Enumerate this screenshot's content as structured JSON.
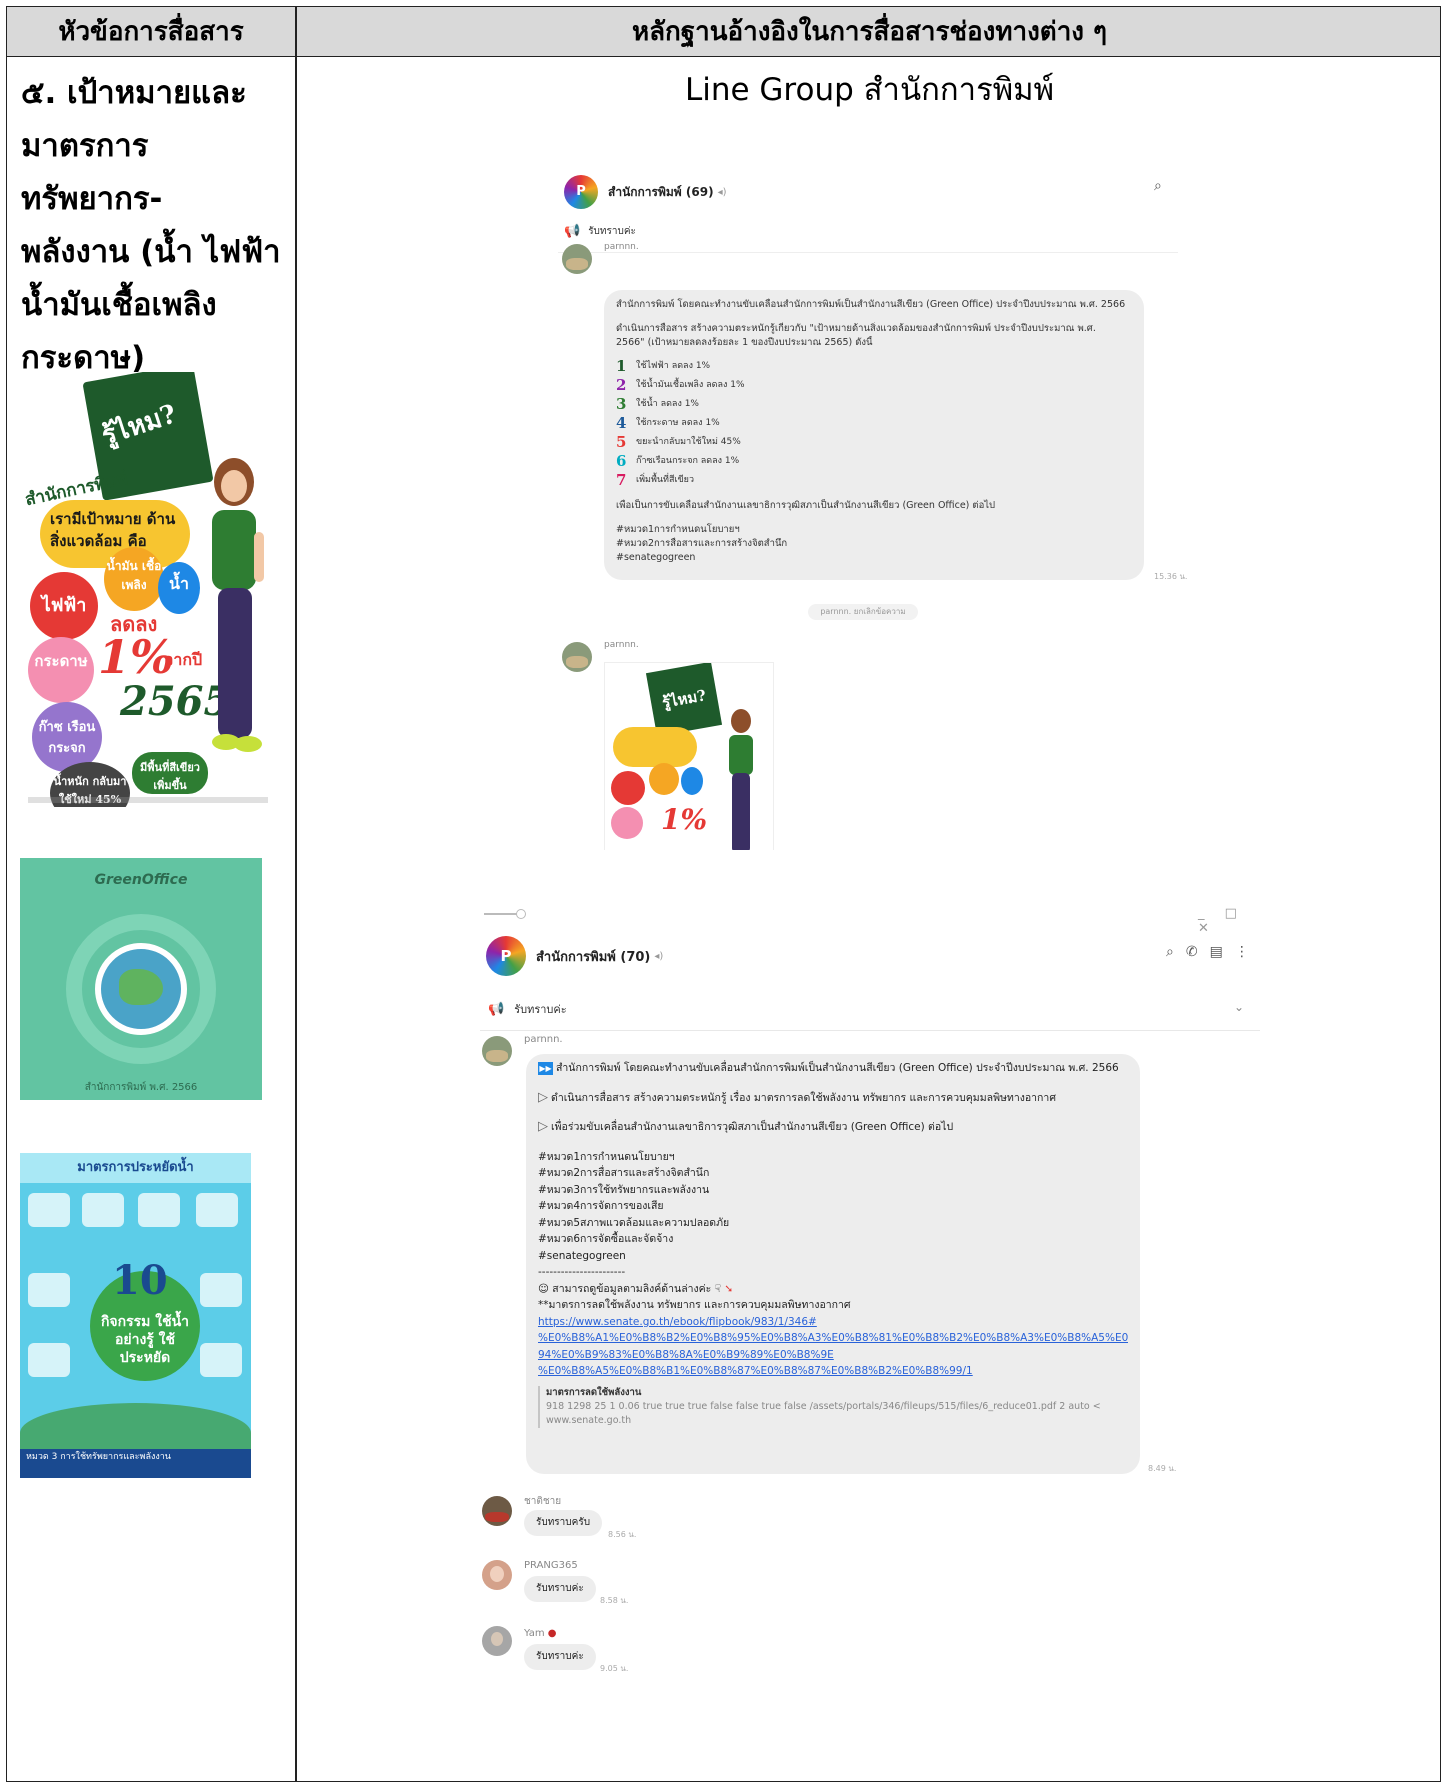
{
  "table": {
    "col1_header": "หัวข้อการสื่อสาร",
    "col2_header": "หลักฐานอ้างอิงในการสื่อสารช่องทางต่าง ๆ",
    "topic_lines": [
      "๕. เป้าหมายและ",
      "มาตรการทรัพยากร-",
      "พลังงาน (น้ำ ไฟฟ้า",
      "น้ำมันเชื้อเพลิง",
      "กระดาษ)"
    ],
    "evidence_title": "Line Group สำนักการพิมพ์"
  },
  "poster1": {
    "board_text": "รู้ไหม?",
    "title": "สำนักการพิมพ์",
    "bubble": "เรามีเป้าหมาย ด้านสิ่งแวดล้อม คือ",
    "circle_electric": "ไฟฟ้า",
    "circle_fuel": "น้ำมัน เชื้อเพลิง",
    "circle_water": "น้ำ",
    "circle_paper": "กระดาษ",
    "circle_gas": "ก๊าซ เรือนกระจก",
    "circle_recycle": "น้ำหนัก กลับมา ใช้ใหม่ 45%",
    "circle_green": "มีพื้นที่สีเขียว เพิ่มขึ้น",
    "reduce": "ลดลง",
    "percent": "1%",
    "from_year": "จากปี",
    "year": "2565"
  },
  "poster2": {
    "title": "GreenOffice",
    "footer": "สำนักการพิมพ์ พ.ศ. 2566"
  },
  "poster3": {
    "title": "มาตรการประหยัดน้ำ",
    "number": "10",
    "activity": "กิจกรรม ใช้น้ำอย่างรู้ ใช้ประหยัด",
    "footer": "หมวด 3 การใช้ทรัพยากรและพลังงาน"
  },
  "chat1": {
    "group_name": "สำนักการพิมพ์ (69)",
    "announcement": "รับทราบค่ะ",
    "sender": "parnnn.",
    "lines_top": [
      "สำนักการพิมพ์ โดยคณะทำงานขับเคลื่อนสำนักการพิมพ์เป็นสำนักงานสีเขียว (Green Office) ประจำปีงบประมาณ พ.ศ. 2566",
      "ดำเนินการสื่อสาร สร้างความตระหนักรู้เกี่ยวกับ \"เป้าหมายด้านสิ่งแวดล้อมของสำนักการพิมพ์ ประจำปีงบประมาณ พ.ศ.",
      "2566\" (เป้าหมายลดลงร้อยละ 1 ของปีงบประมาณ 2565) ดังนี้"
    ],
    "items": [
      {
        "num": "1",
        "color": "#1e5a2b",
        "text": "ใช้ไฟฟ้า ลดลง 1%"
      },
      {
        "num": "2",
        "color": "#8e24aa",
        "text": "ใช้น้ำมันเชื้อเพลิง ลดลง 1%"
      },
      {
        "num": "3",
        "color": "#2e7d32",
        "text": "ใช้น้ำ ลดลง 1%"
      },
      {
        "num": "4",
        "color": "#1e5a9a",
        "text": "ใช้กระดาษ ลดลง 1%"
      },
      {
        "num": "5",
        "color": "#e53935",
        "text": "ขยะนำกลับมาใช้ใหม่ 45%"
      },
      {
        "num": "6",
        "color": "#00acc1",
        "text": "ก๊าซเรือนกระจก ลดลง 1%"
      },
      {
        "num": "7",
        "color": "#d81b60",
        "text": "เพิ่มพื้นที่สีเขียว"
      }
    ],
    "closing": "เพื่อเป็นการขับเคลื่อนสำนักงานเลขาธิการวุฒิสภาเป็นสำนักงานสีเขียว (Green Office) ต่อไป",
    "tags": [
      "#หมวด1การกำหนดนโยบายฯ",
      "#หมวด2การสื่อสารและการสร้างจิตสำนึก",
      "#senategogreen"
    ],
    "time": "15.36 น.",
    "system": "parnnn. ยกเลิกข้อความ",
    "sender2": "parnnn."
  },
  "chat2": {
    "group_name": "สำนักการพิมพ์ (70)",
    "announcement": "รับทราบค่ะ",
    "sender": "parnnn.",
    "line1": "สำนักการพิมพ์ โดยคณะทำงานขับเคลื่อนสำนักการพิมพ์เป็นสำนักงานสีเขียว (Green Office) ประจำปีงบประมาณ พ.ศ. 2566",
    "line2": "ดำเนินการสื่อสาร สร้างความตระหนักรู้ เรื่อง มาตรการลดใช้พลังงาน ทรัพยากร และการควบคุมมลพิษทางอากาศ",
    "line3": "เพื่อร่วมขับเคลื่อนสำนักงานเลขาธิการวุฒิสภาเป็นสำนักงานสีเขียว (Green Office) ต่อไป",
    "tags": [
      "#หมวด1การกำหนดนโยบายฯ",
      "#หมวด2การสื่อสารและสร้างจิตสำนึก",
      "#หมวด3การใช้ทรัพยากรและพลังงาน",
      "#หมวด4การจัดการของเสีย",
      "#หมวด5สภาพแวดล้อมและความปลอดภัย",
      "#หมวด6การจัดซื้อและจัดจ้าง",
      "#senategogreen"
    ],
    "divider": "-----------------------",
    "see_more": "สามารถดูข้อมูลตามลิงค์ด้านล่างค่ะ",
    "measure": "**มาตรการลดใช้พลังงาน ทรัพยากร และการควบคุมมลพิษทางอากาศ",
    "link_lines": [
      "https://www.senate.go.th/ebook/flipbook/983/1/346#",
      "%E0%B8%A1%E0%B8%B2%E0%B8%95%E0%B8%A3%E0%B8%81%E0%B8%B2%E0%B8%A3%E0%B8%A5%E0%B8%",
      "94%E0%B9%83%E0%B8%8A%E0%B9%89%E0%B8%9E",
      "%E0%B8%A5%E0%B8%B1%E0%B8%87%E0%B8%87%E0%B8%B2%E0%B8%99/1"
    ],
    "preview_title": "มาตรการลดใช้พลังงาน",
    "preview_body1": "918 1298 25 1 0.06 true true true false false true false /assets/portals/346/fileups/515/files/6_reduce01.pdf 2 auto <",
    "preview_body2": "www.senate.go.th",
    "time": "8.49 น.",
    "replies": [
      {
        "name": "ชาติชาย",
        "text": "รับทราบครับ",
        "time": "8.56 น."
      },
      {
        "name": "PRANG365",
        "text": "รับทราบค่ะ",
        "time": "8.58 น."
      },
      {
        "name": "Yam",
        "text": "รับทราบค่ะ",
        "time": "9.05 น."
      }
    ]
  }
}
